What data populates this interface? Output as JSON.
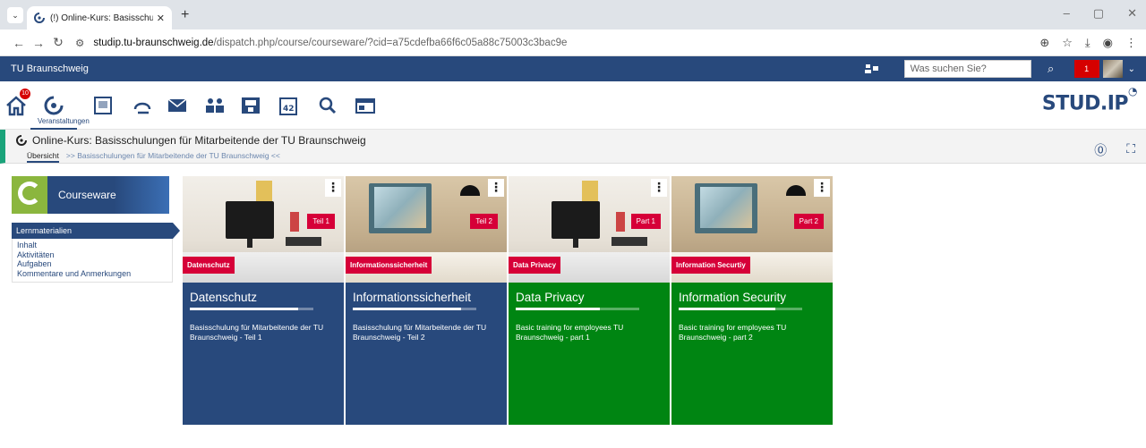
{
  "browser": {
    "tab_title": "(!) Online-Kurs: Basisschulunge",
    "url_domain": "studip.tu-braunschweig.de",
    "url_path": "/dispatch.php/course/courseware/?cid=a75cdefba66f6c05a88c75003c3bac9e"
  },
  "header": {
    "university": "TU Braunschweig",
    "search_placeholder": "Was suchen Sie?",
    "notification_count": "1"
  },
  "nav": {
    "home_badge": "10",
    "active_label": "Veranstaltungen",
    "logo_text": "STUD.IP"
  },
  "course": {
    "title": "Online-Kurs: Basisschulungen für Mitarbeitende der TU Braunschweig",
    "overview_tab": "Übersicht",
    "breadcrumb": ">> Basisschulungen für Mitarbeitende der TU Braunschweig <<"
  },
  "sidebar": {
    "header": "Courseware",
    "selected": "Lernmaterialien",
    "links": [
      "Inhalt",
      "Aktivitäten",
      "Aufgaben",
      "Kommentare und Anmerkungen"
    ]
  },
  "cards": [
    {
      "title": "Datenschutz",
      "tag": "Datenschutz",
      "corner": "Teil 1",
      "progress": 0.88,
      "desc": "Basisschulung für Mitarbeitende der TU Braunschweig - Teil 1",
      "color": "#28497c"
    },
    {
      "title": "Informationssicherheit",
      "tag": "Informationssicherheit",
      "corner": "Teil 2",
      "progress": 0.88,
      "desc": "Basisschulung für Mitarbeitende der TU Braunschweig - Teil 2",
      "color": "#28497c"
    },
    {
      "title": "Data Privacy",
      "tag": "Data Privacy",
      "corner": "Part 1",
      "progress": 0.68,
      "desc": "Basic training for employees TU Braunschweig - part 1",
      "color": "#008512"
    },
    {
      "title": "Information Security",
      "tag": "Information Securtiy",
      "corner": "Part 2",
      "progress": 0.78,
      "desc": "Basic training for employees TU Braunschweig - part 2",
      "color": "#008512"
    }
  ]
}
